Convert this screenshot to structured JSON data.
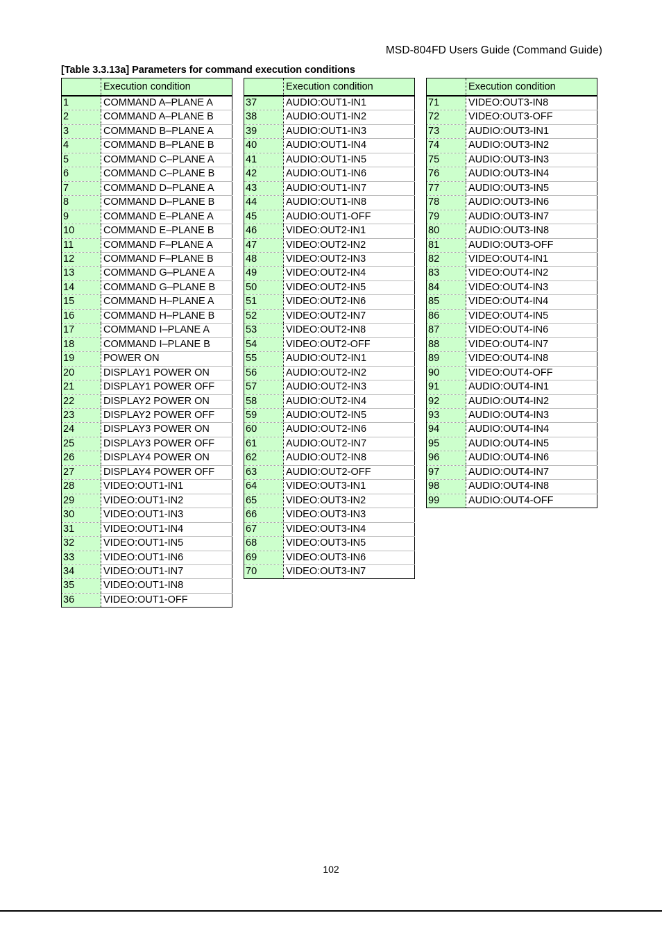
{
  "document": {
    "header_title": "MSD-804FD Users Guide (Command Guide)",
    "caption": "[Table 3.3.13a] Parameters for command execution conditions",
    "page_number": "102",
    "colors": {
      "cell_green": "#CCFFCC",
      "border_black": "#000000",
      "row_line_gray": "#B9B9B9"
    }
  },
  "tables": [
    {
      "header": {
        "num": "",
        "condition": "Execution condition"
      },
      "rows": [
        {
          "num": "1",
          "condition": "COMMAND A–PLANE A"
        },
        {
          "num": "2",
          "condition": "COMMAND A–PLANE B"
        },
        {
          "num": "3",
          "condition": "COMMAND B–PLANE A"
        },
        {
          "num": "4",
          "condition": "COMMAND B–PLANE B"
        },
        {
          "num": "5",
          "condition": "COMMAND C–PLANE A"
        },
        {
          "num": "6",
          "condition": "COMMAND C–PLANE B"
        },
        {
          "num": "7",
          "condition": "COMMAND D–PLANE A"
        },
        {
          "num": "8",
          "condition": "COMMAND D–PLANE B"
        },
        {
          "num": "9",
          "condition": "COMMAND E–PLANE A"
        },
        {
          "num": "10",
          "condition": "COMMAND E–PLANE B"
        },
        {
          "num": "11",
          "condition": "COMMAND F–PLANE A"
        },
        {
          "num": "12",
          "condition": "COMMAND F–PLANE B"
        },
        {
          "num": "13",
          "condition": "COMMAND G–PLANE A"
        },
        {
          "num": "14",
          "condition": "COMMAND G–PLANE B"
        },
        {
          "num": "15",
          "condition": "COMMAND H–PLANE A"
        },
        {
          "num": "16",
          "condition": "COMMAND H–PLANE B"
        },
        {
          "num": "17",
          "condition": "COMMAND I–PLANE A"
        },
        {
          "num": "18",
          "condition": "COMMAND I–PLANE B"
        },
        {
          "num": "19",
          "condition": "POWER ON"
        },
        {
          "num": "20",
          "condition": "DISPLAY1 POWER ON"
        },
        {
          "num": "21",
          "condition": "DISPLAY1 POWER OFF"
        },
        {
          "num": "22",
          "condition": "DISPLAY2 POWER ON"
        },
        {
          "num": "23",
          "condition": "DISPLAY2 POWER OFF"
        },
        {
          "num": "24",
          "condition": "DISPLAY3 POWER ON"
        },
        {
          "num": "25",
          "condition": "DISPLAY3 POWER OFF"
        },
        {
          "num": "26",
          "condition": "DISPLAY4 POWER ON"
        },
        {
          "num": "27",
          "condition": "DISPLAY4 POWER OFF"
        },
        {
          "num": "28",
          "condition": "VIDEO:OUT1-IN1"
        },
        {
          "num": "29",
          "condition": "VIDEO:OUT1-IN2"
        },
        {
          "num": "30",
          "condition": "VIDEO:OUT1-IN3"
        },
        {
          "num": "31",
          "condition": "VIDEO:OUT1-IN4"
        },
        {
          "num": "32",
          "condition": "VIDEO:OUT1-IN5"
        },
        {
          "num": "33",
          "condition": "VIDEO:OUT1-IN6"
        },
        {
          "num": "34",
          "condition": "VIDEO:OUT1-IN7"
        },
        {
          "num": "35",
          "condition": "VIDEO:OUT1-IN8"
        },
        {
          "num": "36",
          "condition": "VIDEO:OUT1-OFF"
        }
      ]
    },
    {
      "header": {
        "num": "",
        "condition": "Execution condition"
      },
      "rows": [
        {
          "num": "37",
          "condition": "AUDIO:OUT1-IN1"
        },
        {
          "num": "38",
          "condition": "AUDIO:OUT1-IN2"
        },
        {
          "num": "39",
          "condition": "AUDIO:OUT1-IN3"
        },
        {
          "num": "40",
          "condition": "AUDIO:OUT1-IN4"
        },
        {
          "num": "41",
          "condition": "AUDIO:OUT1-IN5"
        },
        {
          "num": "42",
          "condition": "AUDIO:OUT1-IN6"
        },
        {
          "num": "43",
          "condition": "AUDIO:OUT1-IN7"
        },
        {
          "num": "44",
          "condition": "AUDIO:OUT1-IN8"
        },
        {
          "num": "45",
          "condition": "AUDIO:OUT1-OFF"
        },
        {
          "num": "46",
          "condition": "VIDEO:OUT2-IN1"
        },
        {
          "num": "47",
          "condition": "VIDEO:OUT2-IN2"
        },
        {
          "num": "48",
          "condition": "VIDEO:OUT2-IN3"
        },
        {
          "num": "49",
          "condition": "VIDEO:OUT2-IN4"
        },
        {
          "num": "50",
          "condition": "VIDEO:OUT2-IN5"
        },
        {
          "num": "51",
          "condition": "VIDEO:OUT2-IN6"
        },
        {
          "num": "52",
          "condition": "VIDEO:OUT2-IN7"
        },
        {
          "num": "53",
          "condition": "VIDEO:OUT2-IN8"
        },
        {
          "num": "54",
          "condition": "VIDEO:OUT2-OFF"
        },
        {
          "num": "55",
          "condition": "AUDIO:OUT2-IN1"
        },
        {
          "num": "56",
          "condition": "AUDIO:OUT2-IN2"
        },
        {
          "num": "57",
          "condition": "AUDIO:OUT2-IN3"
        },
        {
          "num": "58",
          "condition": "AUDIO:OUT2-IN4"
        },
        {
          "num": "59",
          "condition": "AUDIO:OUT2-IN5"
        },
        {
          "num": "60",
          "condition": "AUDIO:OUT2-IN6"
        },
        {
          "num": "61",
          "condition": "AUDIO:OUT2-IN7"
        },
        {
          "num": "62",
          "condition": "AUDIO:OUT2-IN8"
        },
        {
          "num": "63",
          "condition": "AUDIO:OUT2-OFF"
        },
        {
          "num": "64",
          "condition": "VIDEO:OUT3-IN1"
        },
        {
          "num": "65",
          "condition": "VIDEO:OUT3-IN2"
        },
        {
          "num": "66",
          "condition": "VIDEO:OUT3-IN3"
        },
        {
          "num": "67",
          "condition": "VIDEO:OUT3-IN4"
        },
        {
          "num": "68",
          "condition": "VIDEO:OUT3-IN5"
        },
        {
          "num": "69",
          "condition": "VIDEO:OUT3-IN6"
        },
        {
          "num": "70",
          "condition": "VIDEO:OUT3-IN7"
        }
      ]
    },
    {
      "header": {
        "num": "",
        "condition": "Execution condition"
      },
      "rows": [
        {
          "num": "71",
          "condition": "VIDEO:OUT3-IN8"
        },
        {
          "num": "72",
          "condition": "VIDEO:OUT3-OFF"
        },
        {
          "num": "73",
          "condition": "AUDIO:OUT3-IN1"
        },
        {
          "num": "74",
          "condition": "AUDIO:OUT3-IN2"
        },
        {
          "num": "75",
          "condition": "AUDIO:OUT3-IN3"
        },
        {
          "num": "76",
          "condition": "AUDIO:OUT3-IN4"
        },
        {
          "num": "77",
          "condition": "AUDIO:OUT3-IN5"
        },
        {
          "num": "78",
          "condition": "AUDIO:OUT3-IN6"
        },
        {
          "num": "79",
          "condition": "AUDIO:OUT3-IN7"
        },
        {
          "num": "80",
          "condition": "AUDIO:OUT3-IN8"
        },
        {
          "num": "81",
          "condition": "AUDIO:OUT3-OFF"
        },
        {
          "num": "82",
          "condition": "VIDEO:OUT4-IN1"
        },
        {
          "num": "83",
          "condition": "VIDEO:OUT4-IN2"
        },
        {
          "num": "84",
          "condition": "VIDEO:OUT4-IN3"
        },
        {
          "num": "85",
          "condition": "VIDEO:OUT4-IN4"
        },
        {
          "num": "86",
          "condition": "VIDEO:OUT4-IN5"
        },
        {
          "num": "87",
          "condition": "VIDEO:OUT4-IN6"
        },
        {
          "num": "88",
          "condition": "VIDEO:OUT4-IN7"
        },
        {
          "num": "89",
          "condition": "VIDEO:OUT4-IN8"
        },
        {
          "num": "90",
          "condition": "VIDEO:OUT4-OFF"
        },
        {
          "num": "91",
          "condition": "AUDIO:OUT4-IN1"
        },
        {
          "num": "92",
          "condition": "AUDIO:OUT4-IN2"
        },
        {
          "num": "93",
          "condition": "AUDIO:OUT4-IN3"
        },
        {
          "num": "94",
          "condition": "AUDIO:OUT4-IN4"
        },
        {
          "num": "95",
          "condition": "AUDIO:OUT4-IN5"
        },
        {
          "num": "96",
          "condition": "AUDIO:OUT4-IN6"
        },
        {
          "num": "97",
          "condition": "AUDIO:OUT4-IN7"
        },
        {
          "num": "98",
          "condition": "AUDIO:OUT4-IN8"
        },
        {
          "num": "99",
          "condition": "AUDIO:OUT4-OFF"
        }
      ]
    }
  ]
}
